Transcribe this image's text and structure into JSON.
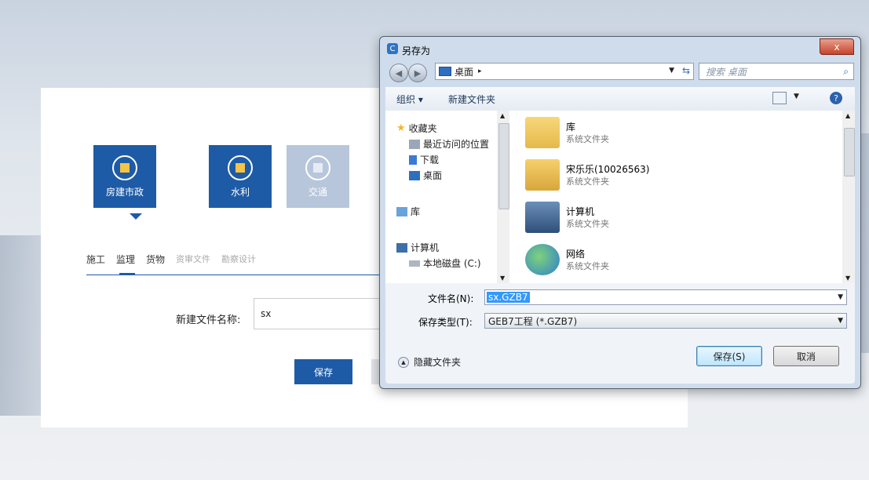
{
  "background_page": {
    "categories": [
      {
        "label": "房建市政",
        "active": true
      },
      {
        "label": "水利",
        "active": true
      },
      {
        "label": "交通",
        "active": false
      }
    ],
    "tabs": [
      {
        "label": "施工"
      },
      {
        "label": "监理"
      },
      {
        "label": "货物"
      },
      {
        "label": "资审文件"
      },
      {
        "label": "勘察设计"
      }
    ],
    "filename_label": "新建文件名称:",
    "filename_value": "sx",
    "save_label": "保存"
  },
  "dialog": {
    "title": "另存为",
    "close_label": "x",
    "address": {
      "path": "桌面",
      "separator": "▸"
    },
    "search_placeholder": "搜索 桌面",
    "toolbar": {
      "organize": "组织 ▾",
      "new_folder": "新建文件夹"
    },
    "nav_items": [
      {
        "label": "收藏夹",
        "icon": "star-icon"
      },
      {
        "label": "最近访问的位置",
        "icon": "recent-places-icon"
      },
      {
        "label": "下载",
        "icon": "download-icon"
      },
      {
        "label": "桌面",
        "icon": "desktop-icon"
      },
      {
        "label": "库",
        "icon": "library-icon"
      },
      {
        "label": "计算机",
        "icon": "computer-icon"
      },
      {
        "label": "本地磁盘 (C:)",
        "icon": "disk-icon"
      }
    ],
    "files": [
      {
        "name": "库",
        "type": "系统文件夹",
        "icon": "library-folder-icon"
      },
      {
        "name": "宋乐乐(10026563)",
        "type": "系统文件夹",
        "icon": "user-folder-icon"
      },
      {
        "name": "计算机",
        "type": "系统文件夹",
        "icon": "computer-icon"
      },
      {
        "name": "网络",
        "type": "系统文件夹",
        "icon": "network-icon"
      }
    ],
    "filename_label": "文件名(N):",
    "filename_value": "sx.GZB7",
    "filetype_label": "保存类型(T):",
    "filetype_value": "GEB7工程 (*.GZB7)",
    "hide_folders": "隐藏文件夹",
    "save_button": "保存(S)",
    "cancel_button": "取消"
  },
  "colors": {
    "accent": "#1e5ba6",
    "selection": "#3399ff",
    "close": "#c7432b"
  }
}
